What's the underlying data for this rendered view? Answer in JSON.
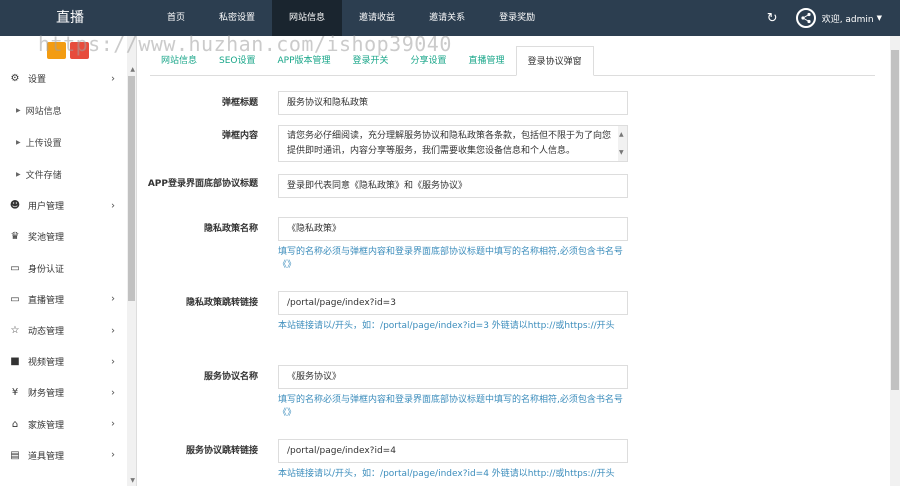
{
  "app": {
    "brand": "直播"
  },
  "nav": [
    {
      "label": "首页"
    },
    {
      "label": "私密设置"
    },
    {
      "label": "网站信息",
      "active": true
    },
    {
      "label": "邀请收益"
    },
    {
      "label": "邀请关系"
    },
    {
      "label": "登录奖励"
    }
  ],
  "user": {
    "greeting": "欢迎, admin"
  },
  "watermark": "https://www.huzhan.com/ishop39040",
  "sidebar": {
    "items": [
      {
        "label": "设置",
        "icon": "gears-icon"
      },
      {
        "label": "网站信息",
        "sub": true
      },
      {
        "label": "上传设置",
        "sub": true
      },
      {
        "label": "文件存储",
        "sub": true
      },
      {
        "label": "用户管理",
        "icon": "users-icon"
      },
      {
        "label": "奖池管理",
        "icon": "trophy-icon"
      },
      {
        "label": "身份认证",
        "icon": "monitor-icon"
      },
      {
        "label": "直播管理",
        "icon": "desktop-icon"
      },
      {
        "label": "动态管理",
        "icon": "star-icon"
      },
      {
        "label": "视频管理",
        "icon": "video-icon"
      },
      {
        "label": "财务管理",
        "icon": "yen-icon"
      },
      {
        "label": "家族管理",
        "icon": "bank-icon"
      },
      {
        "label": "道具管理",
        "icon": "cart-icon"
      }
    ]
  },
  "tabs": [
    {
      "label": "网站信息"
    },
    {
      "label": "SEO设置"
    },
    {
      "label": "APP版本管理"
    },
    {
      "label": "登录开关"
    },
    {
      "label": "分享设置"
    },
    {
      "label": "直播管理"
    },
    {
      "label": "登录协议弹窗",
      "active": true
    }
  ],
  "form": {
    "popup_title_label": "弹框标题",
    "popup_title_value": "服务协议和隐私政策",
    "popup_content_label": "弹框内容",
    "popup_content_value": "请您务必仔细阅读，充分理解服务协议和隐私政策各条款，包括但不限于为了向您提供即时通讯，内容分享等服务，我们需要收集您设备信息和个人信息。",
    "bottom_title_label": "APP登录界面底部协议标题",
    "bottom_title_value": "登录即代表同意《隐私政策》和《服务协议》",
    "privacy_name_label": "隐私政策名称",
    "privacy_name_value": "《隐私政策》",
    "privacy_name_help": "填写的名称必须与弹框内容和登录界面底部协议标题中填写的名称相符,必须包含书名号《》",
    "privacy_link_label": "隐私政策跳转链接",
    "privacy_link_value": "/portal/page/index?id=3",
    "privacy_link_help": "本站链接请以/开头，如：/portal/page/index?id=3 外链请以http://或https://开头",
    "service_name_label": "服务协议名称",
    "service_name_value": "《服务协议》",
    "service_name_help": "填写的名称必须与弹框内容和登录界面底部协议标题中填写的名称相符,必须包含书名号《》",
    "service_link_label": "服务协议跳转链接",
    "service_link_value": "/portal/page/index?id=4",
    "service_link_help": "本站链接请以/开头，如：/portal/page/index?id=4 外链请以http://或https://开头"
  }
}
